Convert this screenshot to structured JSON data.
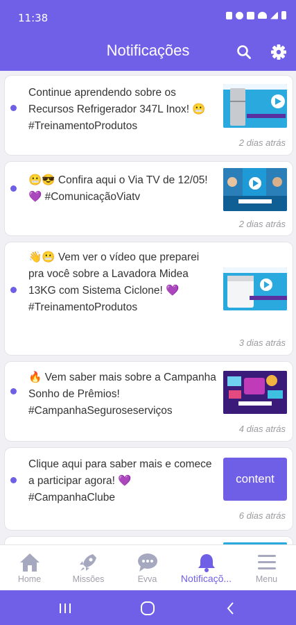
{
  "status_bar": {
    "time": "11:38"
  },
  "header": {
    "title": "Notificações",
    "search_icon": "search-icon",
    "settings_icon": "gear-icon"
  },
  "notifications": [
    {
      "text": "Continue aprendendo sobre os Recursos Refrigerador 347L Inox! 😬 #TreinamentoProdutos",
      "time": "2 dias atrás"
    },
    {
      "text": "😬😎 Confira aqui o Via TV de 12/05! 💜 #ComunicaçãoViatv",
      "time": "2 dias atrás"
    },
    {
      "text": "👋😬 Vem ver o vídeo que preparei pra você sobre a Lavadora Midea 13KG com Sistema Ciclone! 💜 #TreinamentoProdutos",
      "time": "3 dias atrás"
    },
    {
      "text": "🔥 Vem saber mais sobre a Campanha Sonho de Prêmios! #CampanhaSeguroseserviços",
      "time": "4 dias atrás"
    },
    {
      "text": "Clique aqui para saber mais e comece a participar agora! 💜 #CampanhaClube",
      "time": "6 dias atrás",
      "thumb_label": "content"
    }
  ],
  "bottom_nav": [
    {
      "label": "Home",
      "icon": "home-icon"
    },
    {
      "label": "Missões",
      "icon": "rocket-icon"
    },
    {
      "label": "Evva",
      "icon": "chat-bubble-icon"
    },
    {
      "label": "Notificaçõ...",
      "icon": "bell-icon",
      "active": true
    },
    {
      "label": "Menu",
      "icon": "menu-icon"
    }
  ],
  "colors": {
    "primary": "#7060e8",
    "dot": "#6f5fe6",
    "muted": "#a0a0ac"
  }
}
